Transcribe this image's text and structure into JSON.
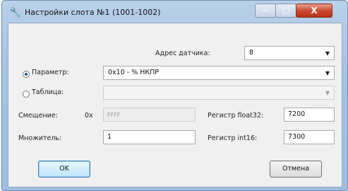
{
  "window": {
    "title": "Настройки слота №1 (1001-1002)",
    "controls": {
      "minimize": "—",
      "maximize": "□",
      "close": "X"
    }
  },
  "form": {
    "sensor_address": {
      "label": "Адрес датчика:",
      "value": "8"
    },
    "parameter": {
      "label": "Параметр:",
      "value": "0x10 - % НКПР",
      "selected": true
    },
    "table": {
      "label": "Таблица:",
      "value": "",
      "selected": false
    },
    "offset": {
      "label": "Смещение:",
      "prefix": "0x",
      "value": "FFFF"
    },
    "multiplier": {
      "label": "Множитель:",
      "value": "1"
    },
    "register_float32": {
      "label": "Регистр float32:",
      "value": "7200"
    },
    "register_int16": {
      "label": "Регистр int16:",
      "value": "7300"
    }
  },
  "buttons": {
    "ok": "OK",
    "cancel": "Отмена"
  },
  "colors": {
    "window_frame": "#a6c2e2",
    "close_button": "#c9452b",
    "client_bg": "#f0f0f0"
  }
}
